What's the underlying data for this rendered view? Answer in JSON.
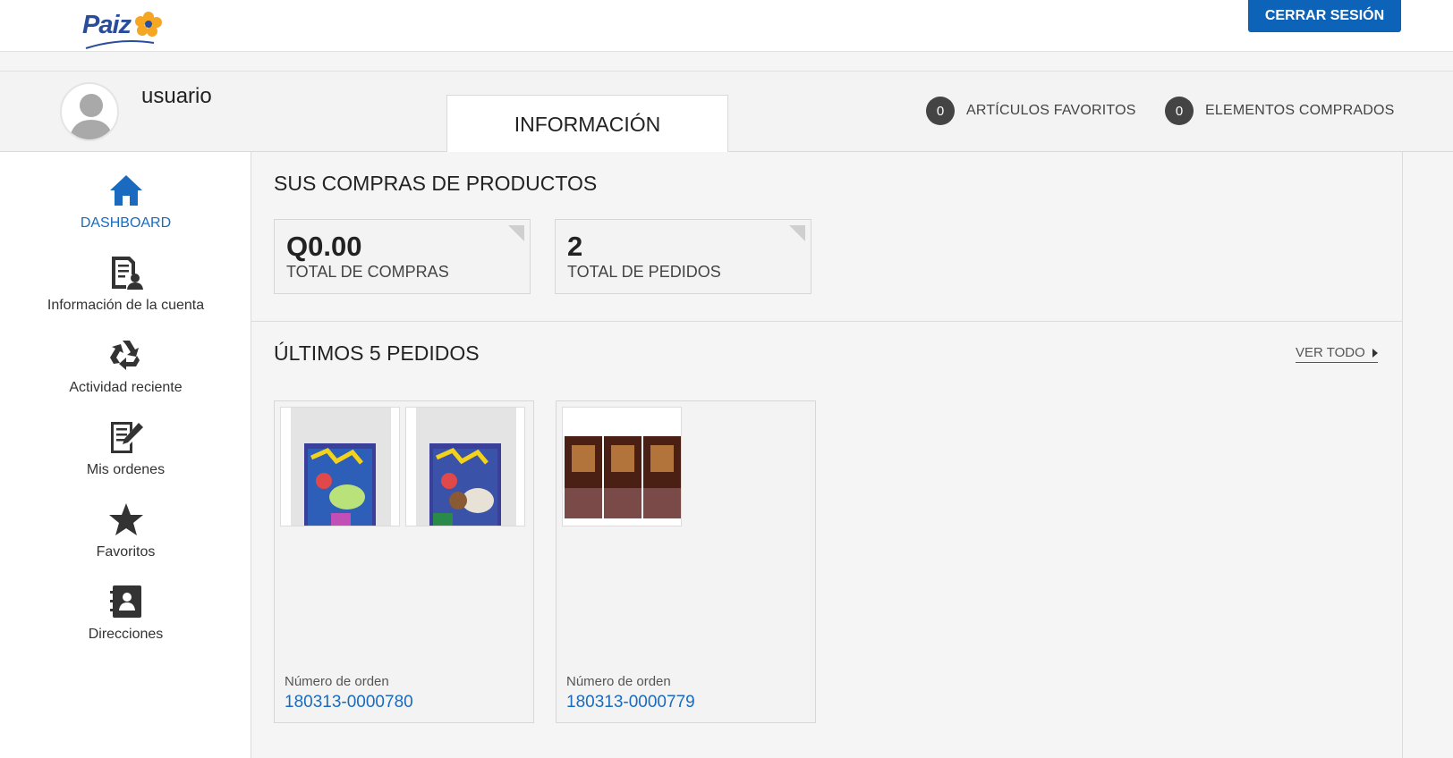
{
  "header": {
    "logo_text": "Paiz",
    "logout_label": "CERRAR SESIÓN"
  },
  "profile": {
    "username": "usuario",
    "tab_label": "INFORMACIÓN",
    "favorites_count": "0",
    "favorites_label": "ARTÍCULOS FAVORITOS",
    "purchased_count": "0",
    "purchased_label": "ELEMENTOS COMPRADOS"
  },
  "sidebar": {
    "items": [
      {
        "label": "DASHBOARD",
        "icon": "home-icon",
        "active": true
      },
      {
        "label": "Información de la cuenta",
        "icon": "account-info-icon"
      },
      {
        "label": "Actividad reciente",
        "icon": "recycle-icon"
      },
      {
        "label": "Mis ordenes",
        "icon": "edit-orders-icon"
      },
      {
        "label": "Favoritos",
        "icon": "star-icon"
      },
      {
        "label": "Direcciones",
        "icon": "address-book-icon"
      }
    ]
  },
  "purchases": {
    "title": "SUS COMPRAS DE PRODUCTOS",
    "total_purchases_value": "Q0.00",
    "total_purchases_label": "TOTAL DE COMPRAS",
    "total_orders_value": "2",
    "total_orders_label": "TOTAL DE PEDIDOS"
  },
  "orders": {
    "title": "ÚLTIMOS 5 PEDIDOS",
    "view_all_label": "VER TODO",
    "order_number_label": "Número de orden",
    "list": [
      {
        "number": "180313-0000780",
        "products": [
          "product-image",
          "product-image"
        ]
      },
      {
        "number": "180313-0000779",
        "products": [
          "product-image"
        ]
      }
    ]
  },
  "colors": {
    "brand_blue": "#0d63b8",
    "link_blue": "#1a6bbf",
    "logo_flower": "#f5a623",
    "badge_dark": "#444444"
  }
}
